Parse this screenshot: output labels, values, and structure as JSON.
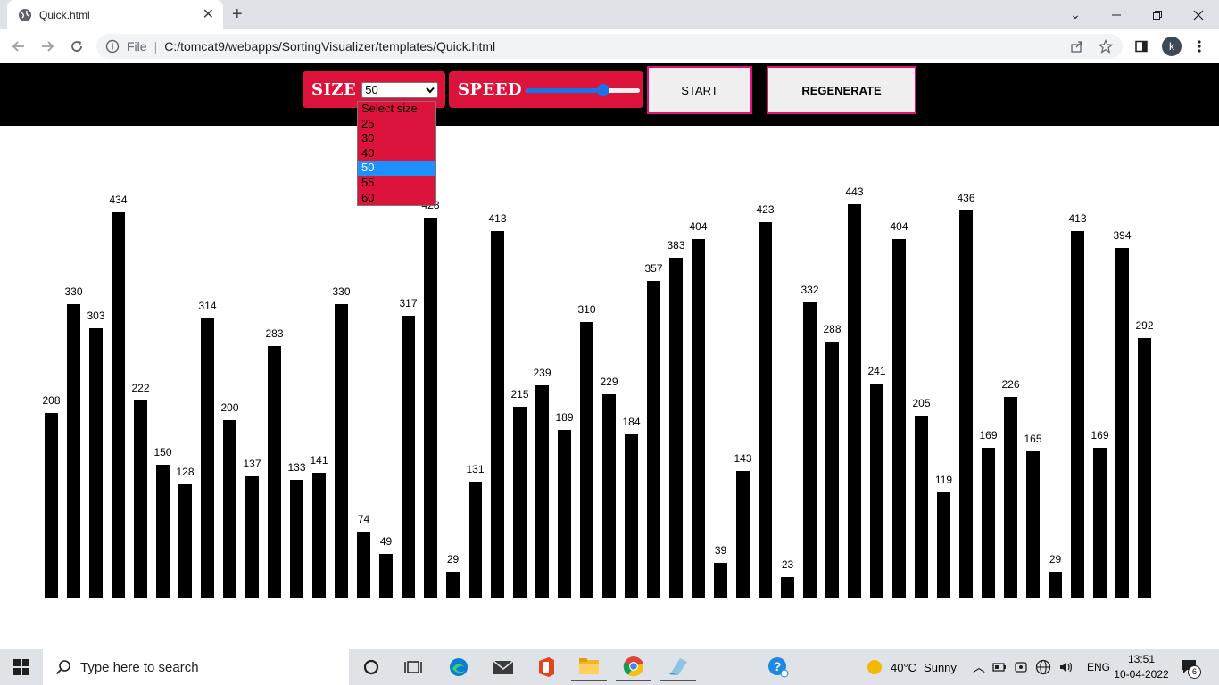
{
  "browser": {
    "tab_title": "Quick.html",
    "new_tab_symbol": "+",
    "url_scheme_label": "File",
    "url": "C:/tomcat9/webapps/SortingVisualizer/templates/Quick.html",
    "profile_initial": "k"
  },
  "header": {
    "size_label": "SIZE",
    "size_selected": "50",
    "size_options": [
      "Select size",
      "25",
      "30",
      "40",
      "50",
      "55",
      "60"
    ],
    "size_highlighted_option": "50",
    "speed_label": "SPEED",
    "speed_value_fraction": 0.7,
    "start_label": "START",
    "regenerate_label": "REGENERATE",
    "accent_color": "#dc143c",
    "button_border_color": "#e0117a"
  },
  "chart_data": {
    "type": "bar",
    "values": [
      208,
      330,
      303,
      434,
      222,
      150,
      128,
      314,
      200,
      137,
      283,
      133,
      141,
      330,
      74,
      49,
      317,
      428,
      29,
      131,
      413,
      215,
      239,
      189,
      310,
      229,
      184,
      357,
      383,
      404,
      39,
      143,
      423,
      23,
      332,
      288,
      443,
      241,
      404,
      205,
      119,
      436,
      169,
      226,
      165,
      29,
      413,
      169,
      394,
      292
    ],
    "bar_color": "#000000",
    "ylim": [
      0,
      443
    ]
  },
  "taskbar": {
    "search_placeholder": "Type here to search",
    "weather_temp": "40°C",
    "weather_text": "Sunny",
    "language": "ENG",
    "time": "13:51",
    "date": "10-04-2022",
    "notification_count": "6"
  }
}
